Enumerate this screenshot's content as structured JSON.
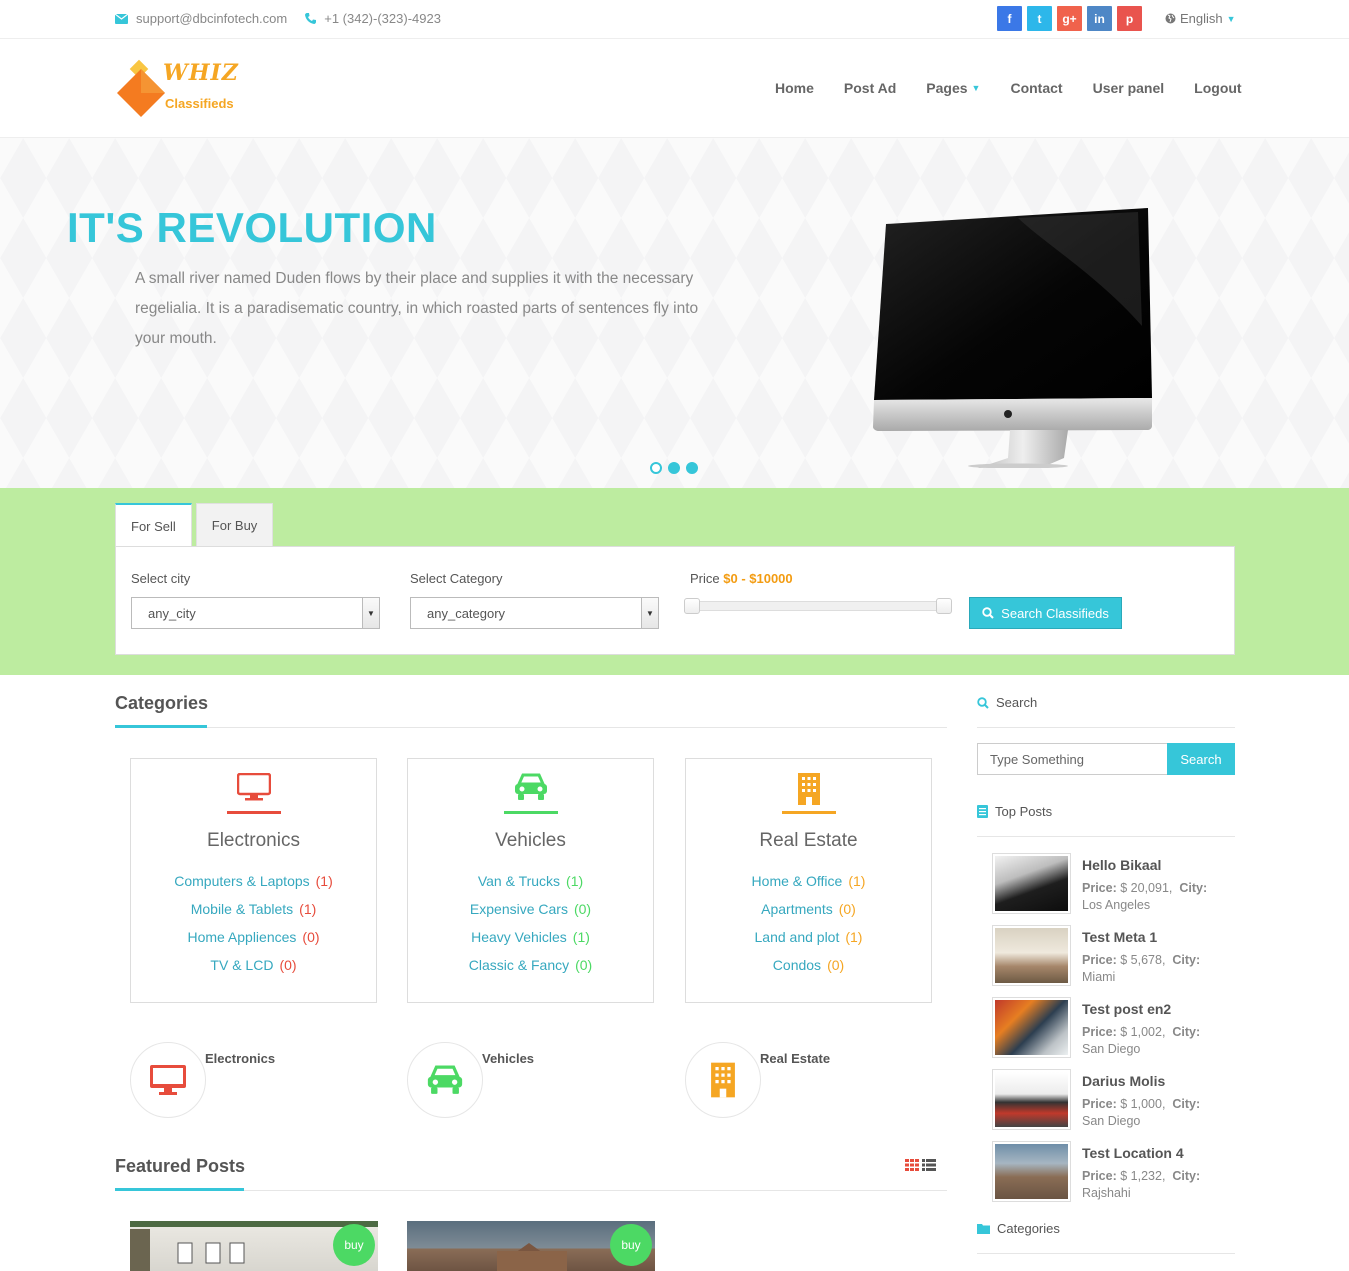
{
  "topbar": {
    "email": "support@dbcinfotech.com",
    "phone": "+1 (342)-(323)-4923",
    "social": [
      {
        "icon": "facebook-icon",
        "glyph": "f",
        "color": "#3b78e7"
      },
      {
        "icon": "twitter-icon",
        "glyph": "t",
        "color": "#2db7ea"
      },
      {
        "icon": "google-plus-icon",
        "glyph": "g+",
        "color": "#f0624c"
      },
      {
        "icon": "linkedin-icon",
        "glyph": "in",
        "color": "#4e87c6"
      },
      {
        "icon": "pinterest-icon",
        "glyph": "p",
        "color": "#e9544e"
      }
    ],
    "language": "English"
  },
  "brand": {
    "name": "WHIZ",
    "tagline": "Classifieds"
  },
  "nav": {
    "home": "Home",
    "post_ad": "Post Ad",
    "pages": "Pages",
    "contact": "Contact",
    "user_panel": "User panel",
    "logout": "Logout"
  },
  "hero": {
    "title": "IT'S REVOLUTION",
    "text": "A small river named Duden flows by their place and supplies it with the necessary regelialia. It is a paradisematic country, in which roasted parts of sentences fly into your mouth.",
    "slides": 3,
    "active_slide": 1
  },
  "search": {
    "tabs": [
      "For Sell",
      "For Buy"
    ],
    "active_tab": "For Sell",
    "city_label": "Select city",
    "city_value": "any_city",
    "category_label": "Select Category",
    "category_value": "any_category",
    "price_label": "Price",
    "price_range": "$0 - $10000",
    "price_min": 0,
    "price_max": 10000,
    "button": "Search Classifieds"
  },
  "categories": {
    "title": "Categories",
    "cards": [
      {
        "name": "Electronics",
        "color": "#e74c3c",
        "items": [
          {
            "label": "Computers & Laptops",
            "count": "(1)"
          },
          {
            "label": "Mobile & Tablets",
            "count": "(1)"
          },
          {
            "label": "Home Appliences",
            "count": "(0)"
          },
          {
            "label": "TV & LCD",
            "count": "(0)"
          }
        ]
      },
      {
        "name": "Vehicles",
        "color": "#4cd964",
        "items": [
          {
            "label": "Van & Trucks",
            "count": "(1)"
          },
          {
            "label": "Expensive Cars",
            "count": "(0)"
          },
          {
            "label": "Heavy Vehicles",
            "count": "(1)"
          },
          {
            "label": "Classic & Fancy",
            "count": "(0)"
          }
        ]
      },
      {
        "name": "Real Estate",
        "color": "#f5a623",
        "items": [
          {
            "label": "Home & Office",
            "count": "(1)"
          },
          {
            "label": "Apartments",
            "count": "(0)"
          },
          {
            "label": "Land and plot",
            "count": "(1)"
          },
          {
            "label": "Condos",
            "count": "(0)"
          }
        ]
      }
    ],
    "circles": [
      "Electronics",
      "Vehicles",
      "Real Estate"
    ]
  },
  "featured": {
    "title": "Featured Posts",
    "posts": [
      {
        "badge": "buy"
      },
      {
        "badge": "buy"
      }
    ]
  },
  "sidebar": {
    "search_title": "Search",
    "search_placeholder": "Type Something",
    "search_button": "Search",
    "top_posts_title": "Top Posts",
    "price_label": "Price:",
    "city_label": "City:",
    "top_posts": [
      {
        "title": "Hello Bikaal",
        "price": "$ 20,091,",
        "city": "Los Angeles"
      },
      {
        "title": "Test Meta 1",
        "price": "$ 5,678,",
        "city": "Miami"
      },
      {
        "title": "Test post en2",
        "price": "$ 1,002,",
        "city": "San Diego"
      },
      {
        "title": "Darius Molis",
        "price": "$ 1,000,",
        "city": "San Diego"
      },
      {
        "title": "Test Location 4",
        "price": "$ 1,232,",
        "city": "Rajshahi"
      }
    ],
    "categories_title": "Categories"
  },
  "colors": {
    "accent": "#36c6d9",
    "band": "#bdeca0",
    "price": "#f39c12",
    "badge": "#4cd964"
  }
}
